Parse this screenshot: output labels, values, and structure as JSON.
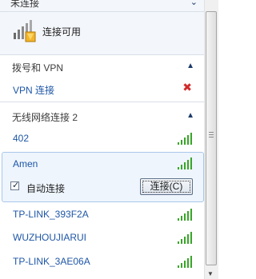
{
  "top": {
    "cut_label": "未连接",
    "status_label": "连接可用"
  },
  "sections": {
    "dialup": {
      "title": "拨号和 VPN"
    },
    "wireless": {
      "title": "无线网络连接 2"
    }
  },
  "vpn": {
    "label": "VPN 连接"
  },
  "networks": [
    {
      "name": "402"
    },
    {
      "name": "Amen"
    },
    {
      "name": "TP-LINK_393F2A"
    },
    {
      "name": "WUZHOUJIARUI"
    },
    {
      "name": "TP-LINK_3AE06A"
    }
  ],
  "expanded": {
    "auto_connect_label": "自动连接",
    "connect_button_label": "连接(C)"
  },
  "colors": {
    "link_blue": "#1e56a6",
    "signal_green": "#3aa52a",
    "disconnect_red": "#d12b2b"
  }
}
